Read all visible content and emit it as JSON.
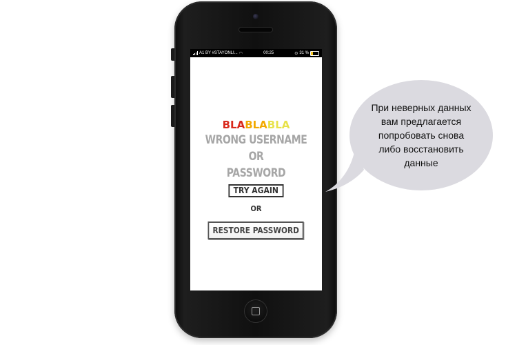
{
  "status_bar": {
    "carrier": "A1 BY #STAYONLI...",
    "time": "00:25",
    "battery": "31 %",
    "battery_level": 0.31,
    "signal_icon": "cellular-signal-icon",
    "wifi_icon": "wifi-icon",
    "lock_icon": "orientation-lock-icon"
  },
  "app": {
    "logo_parts": [
      "BLA",
      "BLA",
      "BLA"
    ],
    "error_lines": [
      "WRONG USERNAME OR",
      "PASSWORD"
    ],
    "try_again_label": "TRY AGAIN",
    "or_label": "OR",
    "restore_label": "RESTORE PASSWORD"
  },
  "callout": {
    "lines": [
      "При неверных данных",
      "вам предлагается",
      "попробовать снова",
      "либо восстановить",
      "данные"
    ]
  },
  "colors": {
    "logo_red": "#d92a1c",
    "logo_orange": "#f2a900",
    "logo_yellow": "#e8e24a",
    "error_gray": "#a6a6a6",
    "bubble": "#dbdae0"
  }
}
